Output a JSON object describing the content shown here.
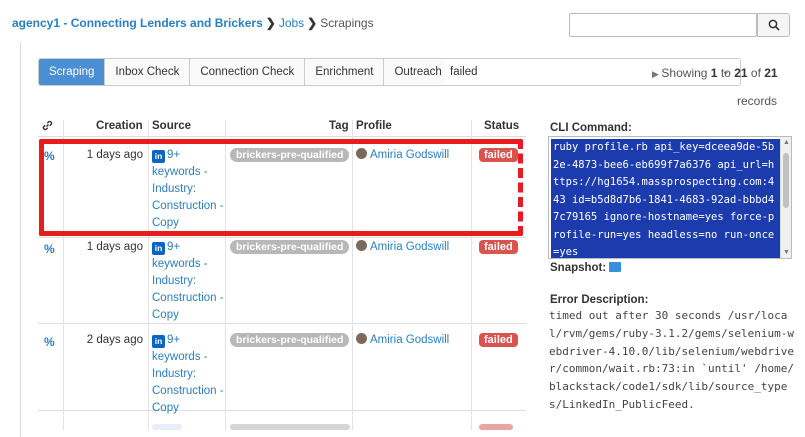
{
  "breadcrumb": {
    "agency": "agency1 - Connecting Lenders and Brickers",
    "jobs": "Jobs",
    "current": "Scrapings"
  },
  "search": {
    "placeholder": "",
    "value": ""
  },
  "tabs": [
    {
      "label": "Scraping",
      "active": true
    },
    {
      "label": "Inbox Check",
      "active": false
    },
    {
      "label": "Connection Check",
      "active": false
    },
    {
      "label": "Enrichment",
      "active": false
    },
    {
      "label": "Outreach",
      "active": false
    }
  ],
  "filter": {
    "selected": "failed"
  },
  "pagination": {
    "prefix": "Showing",
    "from": "1",
    "to_word": "to",
    "to": "21",
    "of_word": "of",
    "total": "21",
    "suffix": "records"
  },
  "table": {
    "headers": {
      "creation": "Creation",
      "source": "Source",
      "tag": "Tag",
      "profile": "Profile",
      "status": "Status"
    },
    "rows": [
      {
        "creation": "1 days ago",
        "source": "9+ keywords - Industry: Construction - Copy",
        "tag": "brickers-pre-qualified",
        "profile": "Amiria Godswill",
        "status": "failed"
      },
      {
        "creation": "1 days ago",
        "source": "9+ keywords - Industry: Construction - Copy",
        "tag": "brickers-pre-qualified",
        "profile": "Amiria Godswill",
        "status": "failed"
      },
      {
        "creation": "2 days ago",
        "source": "9+ keywords - Industry: Construction - Copy",
        "tag": "brickers-pre-qualified",
        "profile": "Amiria Godswill",
        "status": "failed"
      }
    ]
  },
  "details": {
    "cli_label": "CLI Command:",
    "cli_text": "ruby profile.rb api_key=dceea9de-5b2e-4873-bee6-eb699f7a6376 api_url=https://hg1654.massprospecting.com:443 id=b5d8d7b6-1841-4683-92ad-bbbd47c79165 ignore-hostname=yes force-profile-run=yes headless=no run-once=yes",
    "snapshot_label": "Snapshot:",
    "error_label": "Error Description:",
    "error_text": "timed out after 30 seconds /usr/local/rvm/gems/ruby-3.1.2/gems/selenium-webdriver-4.10.0/lib/selenium/webdriver/common/wait.rb:73:in `until' /home/blackstack/code1/sdk/lib/source_types/LinkedIn_PublicFeed."
  },
  "colors": {
    "accent": "#2a7fbf",
    "tab_active": "#4a8fd4",
    "failed": "#d9534f",
    "tag": "#b8b8b8",
    "highlight": "#e81c1c",
    "cli_bg": "#1c3cad"
  },
  "icons": {
    "link": "link-icon",
    "linkedin": "linkedin-icon",
    "search": "search-icon",
    "image": "image-icon",
    "chevron": "chevron-right-icon"
  }
}
